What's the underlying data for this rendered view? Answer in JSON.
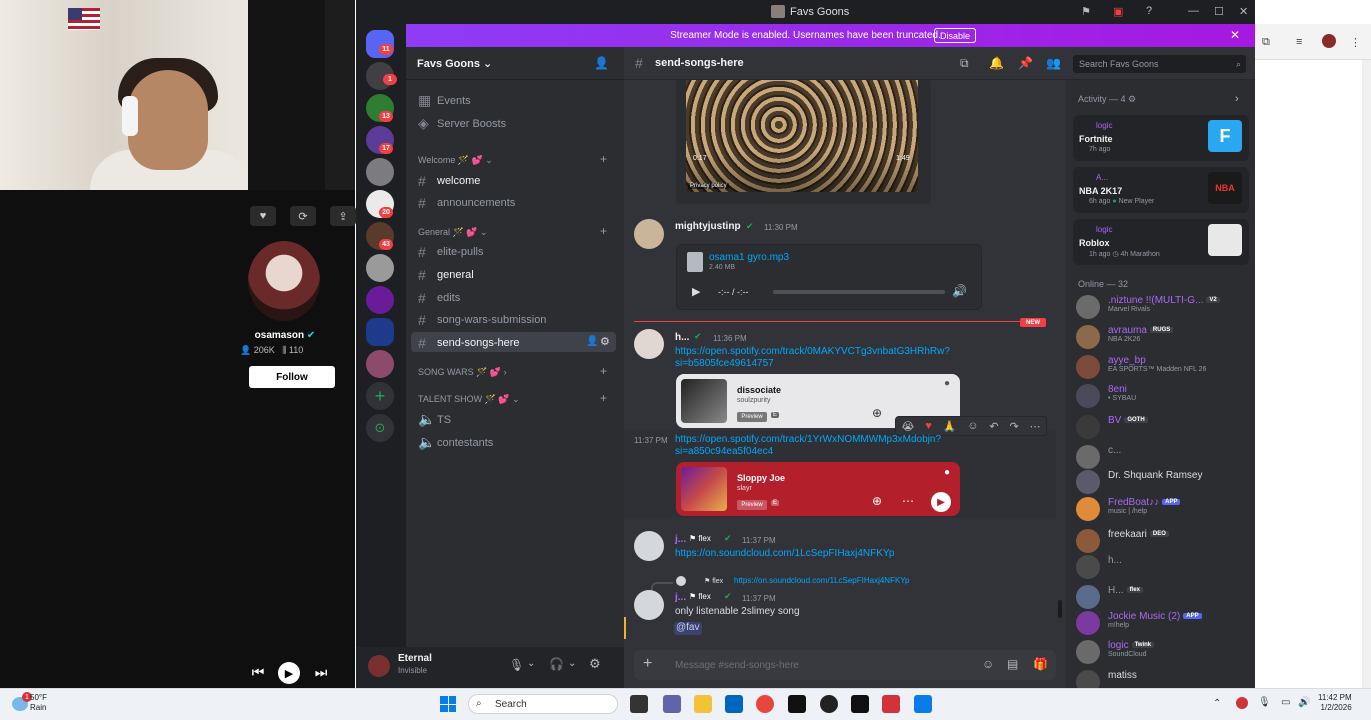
{
  "window": {
    "title": "Favs Goons"
  },
  "banner": {
    "text": "Streamer Mode is enabled. Usernames have been truncated.",
    "button": "Disable"
  },
  "tiktok": {
    "name": "osamason",
    "followers": "206K",
    "following": "110",
    "follow_label": "Follow"
  },
  "server_badges": [
    "11",
    "1",
    "13",
    "17",
    "20",
    "43"
  ],
  "server": {
    "name": "Favs Goons"
  },
  "channels": {
    "events": "Events",
    "boosts": "Server Boosts",
    "cat_welcome": "Welcome",
    "welcome": "welcome",
    "announcements": "announcements",
    "cat_general": "General",
    "elite_pulls": "elite-pulls",
    "general": "general",
    "edits": "edits",
    "song_wars": "song-wars-submission",
    "send_songs": "send-songs-here",
    "cat_song_wars": "SONG WARS",
    "cat_talent": "TALENT SHOW",
    "ts": "TS",
    "contestants": "contestants"
  },
  "user": {
    "name": "Eternal",
    "status": "Invisible"
  },
  "chat": {
    "channel": "send-songs-here",
    "search_placeholder": "Search Favs Goons",
    "input_placeholder": "Message #send-songs-here",
    "video": {
      "time_left": "0:17",
      "time_right": "1:49",
      "privacy": "Privacy policy"
    },
    "msg1": {
      "author": "mightyjustinp",
      "time": "11:30 PM",
      "file": "osama1 gyro.mp3",
      "size": "2.40 MB",
      "player": "-:-- / -:--"
    },
    "new_label": "NEW",
    "msg2": {
      "author": "h...",
      "time": "11:36 PM",
      "link": "https://open.spotify.com/track/0MAKYVCTg3vnbatG3HRhRw?si=b5805fce49614757",
      "card": {
        "title": "dissociate",
        "artist": "soulzpurity",
        "preview": "Preview",
        "explicit": "E"
      }
    },
    "msg3": {
      "time": "11:37 PM",
      "link": "https://open.spotify.com/track/1YrWxNOMMWMp3xMdobjn?si=a850c94ea5f04ec4",
      "card": {
        "title": "Sloppy Joe",
        "artist": "slayr",
        "preview": "Preview",
        "explicit": "E"
      }
    },
    "msg4": {
      "author": "j...",
      "tag": "flex",
      "time": "11:37 PM",
      "link": "https://on.soundcloud.com/1LcSepFIHaxj4NFKYp"
    },
    "msg5": {
      "reply_tag": "flex",
      "reply_link": "https://on.soundcloud.com/1LcSepFIHaxj4NFKYp",
      "author": "j...",
      "tag": "flex",
      "time": "11:37 PM",
      "text": "only listenable 2slimey song",
      "mention": "@fav"
    }
  },
  "members": {
    "activity_header": "Activity — 4",
    "activities": [
      {
        "user": "logic",
        "game": "Fortnite",
        "sub": "7h ago"
      },
      {
        "user": "A...",
        "game": "NBA 2K17",
        "sub": "6h ago",
        "extra": "New Player"
      },
      {
        "user": "logic",
        "game": "Roblox",
        "sub": "1h ago",
        "extra": "4h Marathon"
      }
    ],
    "online_header": "Online — 32",
    "list": [
      {
        "name": ".niztune !!(MULTI-G...",
        "tag": "V2",
        "sub": "Marvel Rivals",
        "color": "#a96af5"
      },
      {
        "name": "avrauma",
        "tag": "RUGS",
        "sub": "NBA 2K26",
        "color": "#a96af5"
      },
      {
        "name": "ayye_bp",
        "sub": "EA SPORTS™ Madden NFL 26",
        "color": "#a96af5"
      },
      {
        "name": "8eni",
        "sub": "• SYBAU",
        "color": "#a96af5"
      },
      {
        "name": "BV",
        "tag": "GOTH",
        "color": "#a96af5"
      },
      {
        "name": "c...",
        "color": "#949ba4"
      },
      {
        "name": "Dr. Shquank Ramsey",
        "color": "#dbdee1"
      },
      {
        "name": "FredBoat♪♪",
        "tag": "APP",
        "sub": "music | /help",
        "color": "#a96af5"
      },
      {
        "name": "freekaari",
        "tag": "DEO",
        "color": "#dbdee1"
      },
      {
        "name": "h...",
        "color": "#949ba4"
      },
      {
        "name": "H...",
        "tag": "flex",
        "color": "#949ba4"
      },
      {
        "name": "Jockie Music (2)",
        "tag": "APP",
        "sub": "m!help",
        "color": "#a96af5"
      },
      {
        "name": "logic",
        "tag": "Twink",
        "sub": "SoundCloud",
        "color": "#a96af5"
      },
      {
        "name": "matiss",
        "color": "#dbdee1"
      }
    ]
  },
  "taskbar": {
    "temp": "50°F",
    "weather": "Rain",
    "weather_badge": "1",
    "search": "Search",
    "time": "11:42 PM",
    "date": "1/2/2026"
  }
}
